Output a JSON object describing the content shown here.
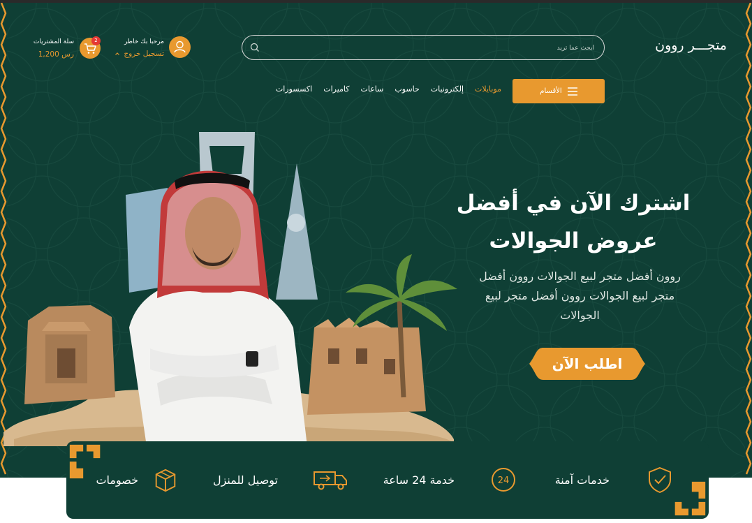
{
  "header": {
    "logo": "متجـــر روون",
    "search_placeholder": "ابحث عما تريد",
    "user_welcome": "مرحبا بك خاطر",
    "logout_label": "تسجيل خروج",
    "cart_label": "سلة المشتريات",
    "cart_total": "1,200 رس",
    "cart_count": "2"
  },
  "nav": {
    "categories_label": "الأقسام",
    "items": [
      "موبايلات",
      "إلكترونيات",
      "حاسوب",
      "ساعات",
      "كاميرات",
      "اكسسورات"
    ]
  },
  "hero": {
    "headline": "اشترك الآن في أفضل عروض الجوالات",
    "subtext": "روون أفضل متجر لبيع الجوالات روون أفضل متجر لبيع الجوالات روون أفضل متجر لبيع الجوالات",
    "cta_label": "اطلب الآن"
  },
  "features": [
    {
      "label": "خدمات آمنة",
      "icon": "shield-check-icon"
    },
    {
      "label": "خدمة 24 ساعة",
      "icon": "clock-24-icon"
    },
    {
      "label": "توصيل للمنزل",
      "icon": "delivery-truck-icon"
    },
    {
      "label": "خصومات",
      "icon": "package-box-icon"
    }
  ],
  "colors": {
    "primary_green": "#0f3f35",
    "accent_orange": "#e8992f"
  }
}
